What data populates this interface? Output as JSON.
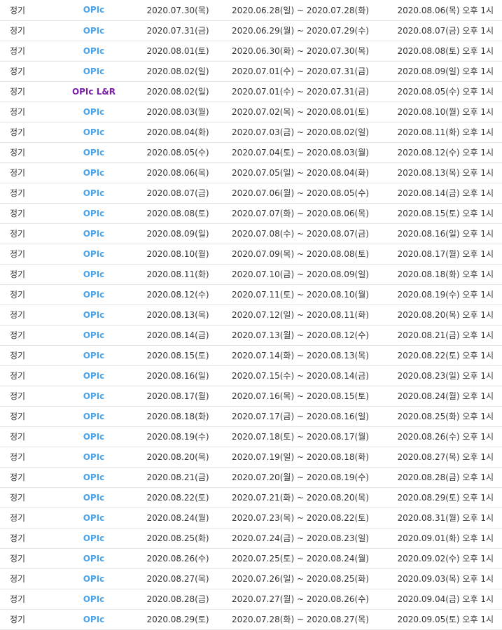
{
  "colors": {
    "opic": "#4aa3e8",
    "opic_lr": "#7a1fa8",
    "text": "#333333",
    "row_border": "#e3e3e3"
  },
  "rows": [
    {
      "type": "정기",
      "test": "OPIc",
      "test_date": "2020.07.30(목)",
      "period": "2020.06.28(일) ~ 2020.07.28(화)",
      "result": "2020.08.06(목) 오후 1시"
    },
    {
      "type": "정기",
      "test": "OPIc",
      "test_date": "2020.07.31(금)",
      "period": "2020.06.29(월) ~ 2020.07.29(수)",
      "result": "2020.08.07(금) 오후 1시"
    },
    {
      "type": "정기",
      "test": "OPIc",
      "test_date": "2020.08.01(토)",
      "period": "2020.06.30(화) ~ 2020.07.30(목)",
      "result": "2020.08.08(토) 오후 1시"
    },
    {
      "type": "정기",
      "test": "OPIc",
      "test_date": "2020.08.02(일)",
      "period": "2020.07.01(수) ~ 2020.07.31(금)",
      "result": "2020.08.09(일) 오후 1시"
    },
    {
      "type": "정기",
      "test": "OPIc L&R",
      "test_date": "2020.08.02(일)",
      "period": "2020.07.01(수) ~ 2020.07.31(금)",
      "result": "2020.08.05(수) 오후 1시"
    },
    {
      "type": "정기",
      "test": "OPIc",
      "test_date": "2020.08.03(월)",
      "period": "2020.07.02(목) ~ 2020.08.01(토)",
      "result": "2020.08.10(월) 오후 1시"
    },
    {
      "type": "정기",
      "test": "OPIc",
      "test_date": "2020.08.04(화)",
      "period": "2020.07.03(금) ~ 2020.08.02(일)",
      "result": "2020.08.11(화) 오후 1시"
    },
    {
      "type": "정기",
      "test": "OPIc",
      "test_date": "2020.08.05(수)",
      "period": "2020.07.04(토) ~ 2020.08.03(월)",
      "result": "2020.08.12(수) 오후 1시"
    },
    {
      "type": "정기",
      "test": "OPIc",
      "test_date": "2020.08.06(목)",
      "period": "2020.07.05(일) ~ 2020.08.04(화)",
      "result": "2020.08.13(목) 오후 1시"
    },
    {
      "type": "정기",
      "test": "OPIc",
      "test_date": "2020.08.07(금)",
      "period": "2020.07.06(월) ~ 2020.08.05(수)",
      "result": "2020.08.14(금) 오후 1시"
    },
    {
      "type": "정기",
      "test": "OPIc",
      "test_date": "2020.08.08(토)",
      "period": "2020.07.07(화) ~ 2020.08.06(목)",
      "result": "2020.08.15(토) 오후 1시"
    },
    {
      "type": "정기",
      "test": "OPIc",
      "test_date": "2020.08.09(일)",
      "period": "2020.07.08(수) ~ 2020.08.07(금)",
      "result": "2020.08.16(일) 오후 1시"
    },
    {
      "type": "정기",
      "test": "OPIc",
      "test_date": "2020.08.10(월)",
      "period": "2020.07.09(목) ~ 2020.08.08(토)",
      "result": "2020.08.17(월) 오후 1시"
    },
    {
      "type": "정기",
      "test": "OPIc",
      "test_date": "2020.08.11(화)",
      "period": "2020.07.10(금) ~ 2020.08.09(일)",
      "result": "2020.08.18(화) 오후 1시"
    },
    {
      "type": "정기",
      "test": "OPIc",
      "test_date": "2020.08.12(수)",
      "period": "2020.07.11(토) ~ 2020.08.10(월)",
      "result": "2020.08.19(수) 오후 1시"
    },
    {
      "type": "정기",
      "test": "OPIc",
      "test_date": "2020.08.13(목)",
      "period": "2020.07.12(일) ~ 2020.08.11(화)",
      "result": "2020.08.20(목) 오후 1시"
    },
    {
      "type": "정기",
      "test": "OPIc",
      "test_date": "2020.08.14(금)",
      "period": "2020.07.13(월) ~ 2020.08.12(수)",
      "result": "2020.08.21(금) 오후 1시"
    },
    {
      "type": "정기",
      "test": "OPIc",
      "test_date": "2020.08.15(토)",
      "period": "2020.07.14(화) ~ 2020.08.13(목)",
      "result": "2020.08.22(토) 오후 1시"
    },
    {
      "type": "정기",
      "test": "OPIc",
      "test_date": "2020.08.16(일)",
      "period": "2020.07.15(수) ~ 2020.08.14(금)",
      "result": "2020.08.23(일) 오후 1시"
    },
    {
      "type": "정기",
      "test": "OPIc",
      "test_date": "2020.08.17(월)",
      "period": "2020.07.16(목) ~ 2020.08.15(토)",
      "result": "2020.08.24(월) 오후 1시"
    },
    {
      "type": "정기",
      "test": "OPIc",
      "test_date": "2020.08.18(화)",
      "period": "2020.07.17(금) ~ 2020.08.16(일)",
      "result": "2020.08.25(화) 오후 1시"
    },
    {
      "type": "정기",
      "test": "OPIc",
      "test_date": "2020.08.19(수)",
      "period": "2020.07.18(토) ~ 2020.08.17(월)",
      "result": "2020.08.26(수) 오후 1시"
    },
    {
      "type": "정기",
      "test": "OPIc",
      "test_date": "2020.08.20(목)",
      "period": "2020.07.19(일) ~ 2020.08.18(화)",
      "result": "2020.08.27(목) 오후 1시"
    },
    {
      "type": "정기",
      "test": "OPIc",
      "test_date": "2020.08.21(금)",
      "period": "2020.07.20(월) ~ 2020.08.19(수)",
      "result": "2020.08.28(금) 오후 1시"
    },
    {
      "type": "정기",
      "test": "OPIc",
      "test_date": "2020.08.22(토)",
      "period": "2020.07.21(화) ~ 2020.08.20(목)",
      "result": "2020.08.29(토) 오후 1시"
    },
    {
      "type": "정기",
      "test": "OPIc",
      "test_date": "2020.08.24(월)",
      "period": "2020.07.23(목) ~ 2020.08.22(토)",
      "result": "2020.08.31(월) 오후 1시"
    },
    {
      "type": "정기",
      "test": "OPIc",
      "test_date": "2020.08.25(화)",
      "period": "2020.07.24(금) ~ 2020.08.23(일)",
      "result": "2020.09.01(화) 오후 1시"
    },
    {
      "type": "정기",
      "test": "OPIc",
      "test_date": "2020.08.26(수)",
      "period": "2020.07.25(토) ~ 2020.08.24(월)",
      "result": "2020.09.02(수) 오후 1시"
    },
    {
      "type": "정기",
      "test": "OPIc",
      "test_date": "2020.08.27(목)",
      "period": "2020.07.26(일) ~ 2020.08.25(화)",
      "result": "2020.09.03(목) 오후 1시"
    },
    {
      "type": "정기",
      "test": "OPIc",
      "test_date": "2020.08.28(금)",
      "period": "2020.07.27(월) ~ 2020.08.26(수)",
      "result": "2020.09.04(금) 오후 1시"
    },
    {
      "type": "정기",
      "test": "OPIc",
      "test_date": "2020.08.29(토)",
      "period": "2020.07.28(화) ~ 2020.08.27(목)",
      "result": "2020.09.05(토) 오후 1시"
    }
  ]
}
